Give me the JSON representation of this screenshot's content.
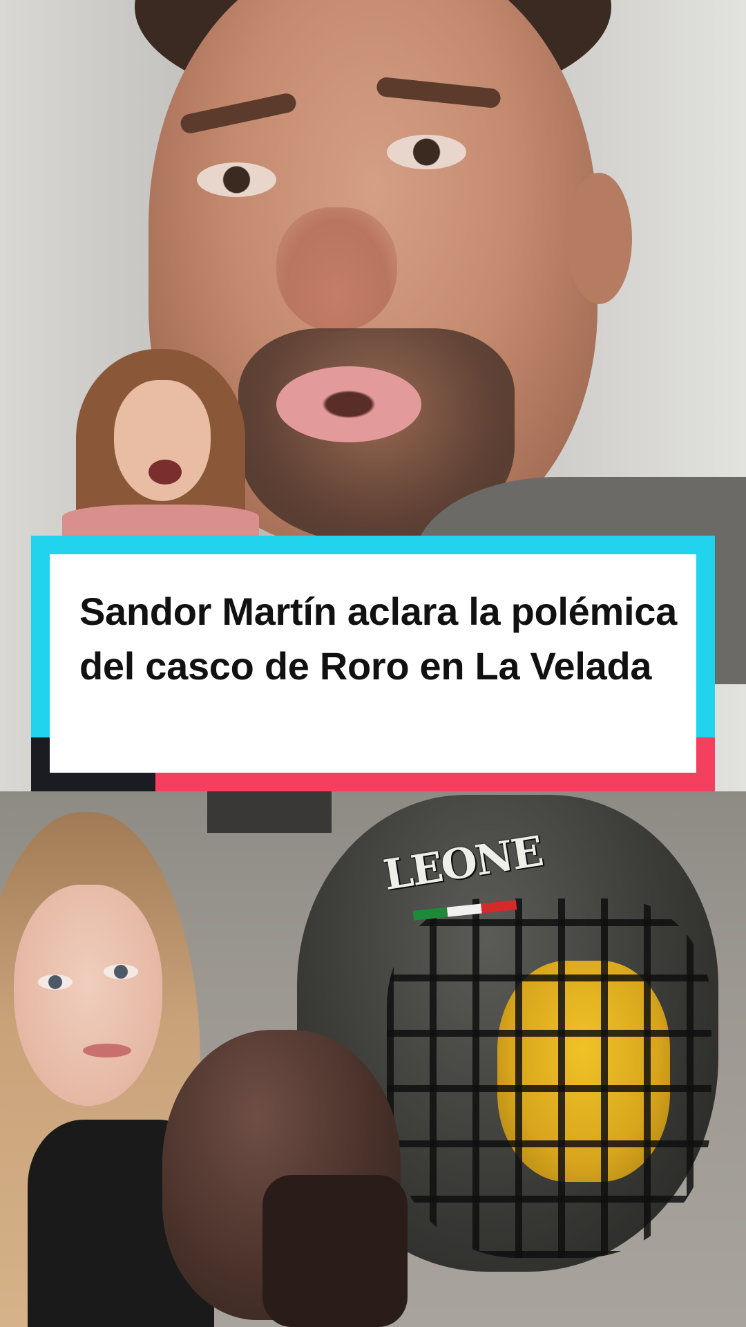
{
  "headline": {
    "text": "Sandor Martín aclara la polémica del casco de Roro en La Velada"
  },
  "helmet": {
    "logo_text": "LEONE"
  },
  "colors": {
    "card_accent_cyan": "#22d3ee",
    "card_accent_red": "#f43f5e",
    "card_accent_dark": "#1a1c22",
    "card_background": "#ffffff",
    "headline_text": "#111111"
  }
}
